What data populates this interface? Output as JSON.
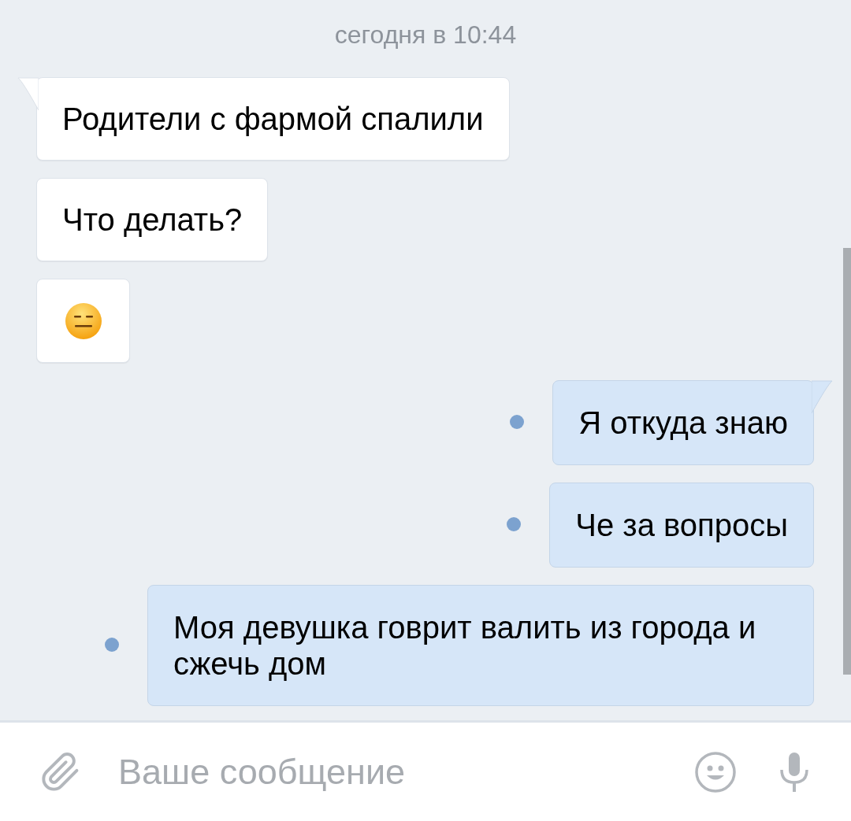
{
  "date_separator": "сегодня в 10:44",
  "messages": [
    {
      "kind": "incoming",
      "text": "Родители с фармой спалили",
      "tail": true
    },
    {
      "kind": "incoming",
      "text": "Что делать?",
      "tail": false
    },
    {
      "kind": "emoji",
      "tail": false
    },
    {
      "kind": "outgoing",
      "text": "Я откуда знаю",
      "tail": true,
      "unread": true
    },
    {
      "kind": "outgoing",
      "text": "Че за вопросы",
      "tail": false,
      "unread": true
    },
    {
      "kind": "outgoing",
      "text": "Моя девушка говрит валить из города и сжечь дом",
      "tail": false,
      "unread": true
    }
  ],
  "composer": {
    "placeholder": "Ваше сообщение"
  }
}
